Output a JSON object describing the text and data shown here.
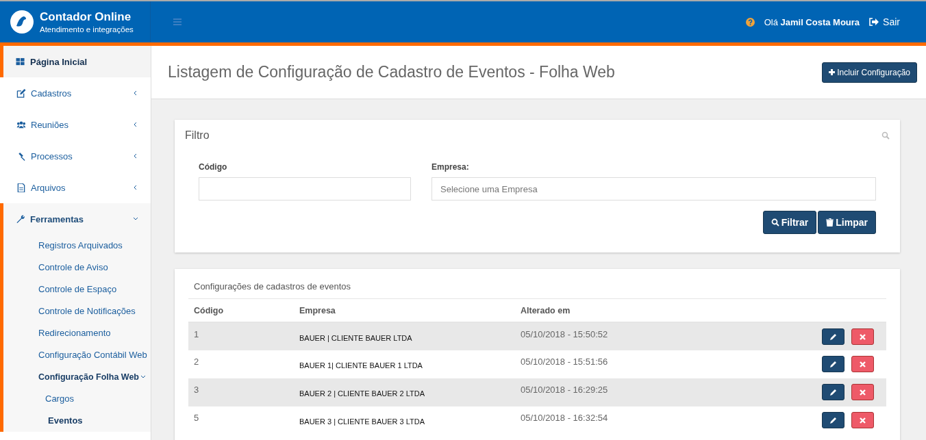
{
  "brand": {
    "title": "Contador Online",
    "subtitle": "Atendimento e integrações"
  },
  "header": {
    "greeting": "Olá",
    "user": "Jamil Costa Moura",
    "logout": "Sair"
  },
  "sidebar": {
    "items": [
      {
        "label": "Página Inicial",
        "selected": true,
        "expanded": false,
        "has_caret": false
      },
      {
        "label": "Cadastros",
        "selected": false,
        "expanded": false,
        "has_caret": true
      },
      {
        "label": "Reuniões",
        "selected": false,
        "expanded": false,
        "has_caret": true
      },
      {
        "label": "Processos",
        "selected": false,
        "expanded": false,
        "has_caret": true
      },
      {
        "label": "Arquivos",
        "selected": false,
        "expanded": false,
        "has_caret": true
      },
      {
        "label": "Ferramentas",
        "selected": false,
        "expanded": true,
        "has_caret": true,
        "children": [
          {
            "label": "Registros Arquivados",
            "selected": false
          },
          {
            "label": "Controle de Aviso",
            "selected": false
          },
          {
            "label": "Controle de Espaço",
            "selected": false
          },
          {
            "label": "Controle de Notificações",
            "selected": false
          },
          {
            "label": "Redirecionamento",
            "selected": false
          },
          {
            "label": "Configuração Contábil Web",
            "selected": false
          },
          {
            "label": "Configuração Folha Web",
            "selected": true,
            "expanded": true,
            "children": [
              {
                "label": "Cargos",
                "selected": false
              },
              {
                "label": "Eventos",
                "selected": true
              }
            ]
          }
        ]
      }
    ]
  },
  "page": {
    "title": "Listagem de Configuração de Cadastro de Eventos - Folha Web",
    "add_button": "Incluir Configuração"
  },
  "filter": {
    "title": "Filtro",
    "fields": [
      {
        "label": "Código"
      },
      {
        "label": "Empresa:",
        "placeholder": "Selecione uma Empresa"
      }
    ],
    "buttons": [
      "Filtrar",
      "Limpar"
    ]
  },
  "table": {
    "title": "Configurações de cadastros de eventos",
    "columns": [
      "Código",
      "Empresa",
      "Alterado em"
    ],
    "rows": [
      {
        "code": "1",
        "company": "BAUER | CLIENTE BAUER LTDA",
        "changed": "05/10/2018 - 15:50:52"
      },
      {
        "code": "2",
        "company": "BAUER 1| CLIENTE BAUER 1 LTDA",
        "changed": "05/10/2018 - 15:51:56"
      },
      {
        "code": "3",
        "company": "BAUER 2 | CLIENTE BAUER 2 LTDA",
        "changed": "05/10/2018 - 16:29:25"
      },
      {
        "code": "5",
        "company": "BAUER 3 | CLIENTE BAUER 3 LTDA",
        "changed": "05/10/2018 - 16:32:54"
      }
    ]
  }
}
